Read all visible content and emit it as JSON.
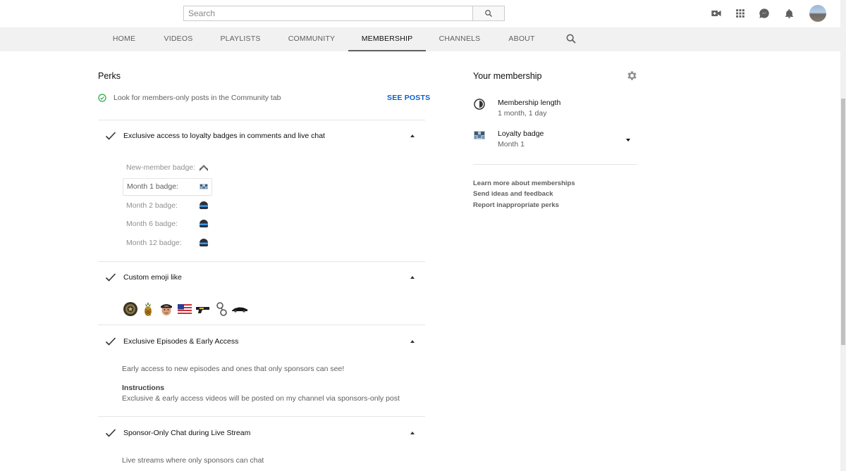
{
  "search": {
    "placeholder": "Search"
  },
  "header_icons": [
    "create-video-icon",
    "apps-grid-icon",
    "messages-icon",
    "notifications-bell-icon"
  ],
  "tabs": [
    {
      "label": "HOME"
    },
    {
      "label": "VIDEOS"
    },
    {
      "label": "PLAYLISTS"
    },
    {
      "label": "COMMUNITY"
    },
    {
      "label": "MEMBERSHIP",
      "active": true
    },
    {
      "label": "CHANNELS"
    },
    {
      "label": "ABOUT"
    }
  ],
  "perks": {
    "title": "Perks",
    "community_note": "Look for members-only posts in the Community tab",
    "see_posts": "SEE POSTS",
    "badges_section": {
      "title": "Exclusive access to loyalty badges in comments and live chat",
      "badges": [
        {
          "label": "New-member badge:",
          "icon": "chevron-rank-badge-icon"
        },
        {
          "label": "Month 1 badge:",
          "icon": "pixel-badge-icon",
          "selected": true
        },
        {
          "label": "Month 2 badge:",
          "icon": "blue-stripe-badge-icon"
        },
        {
          "label": "Month 6 badge:",
          "icon": "blue-stripe-badge-icon"
        },
        {
          "label": "Month 12 badge:",
          "icon": "blue-stripe-badge-icon"
        }
      ]
    },
    "emoji_section": {
      "title": "Custom emoji like",
      "emojis": [
        "seal-emoji",
        "pineapple-emoji",
        "face-emoji",
        "us-flag-emoji",
        "gun-emoji",
        "handcuffs-emoji",
        "car-emoji"
      ]
    },
    "episodes_section": {
      "title": "Exclusive Episodes & Early Access",
      "description": "Early access to new episodes and ones that only sponsors can see!",
      "instructions_label": "Instructions",
      "instructions_text": "Exclusive & early access videos will be posted on my channel via sponsors-only post"
    },
    "chat_section": {
      "title": "Sponsor-Only Chat during Live Stream",
      "description": "Live streams where only sponsors can chat"
    }
  },
  "membership": {
    "title": "Your membership",
    "length_label": "Membership length",
    "length_value": "1 month, 1 day",
    "badge_label": "Loyalty badge",
    "badge_value": "Month 1",
    "links": [
      "Learn more about memberships",
      "Send ideas and feedback",
      "Report inappropriate perks"
    ]
  },
  "colors": {
    "accent_link": "#065fd4",
    "check_green": "#2ba640",
    "tab_bar": "#f1f1f1"
  }
}
